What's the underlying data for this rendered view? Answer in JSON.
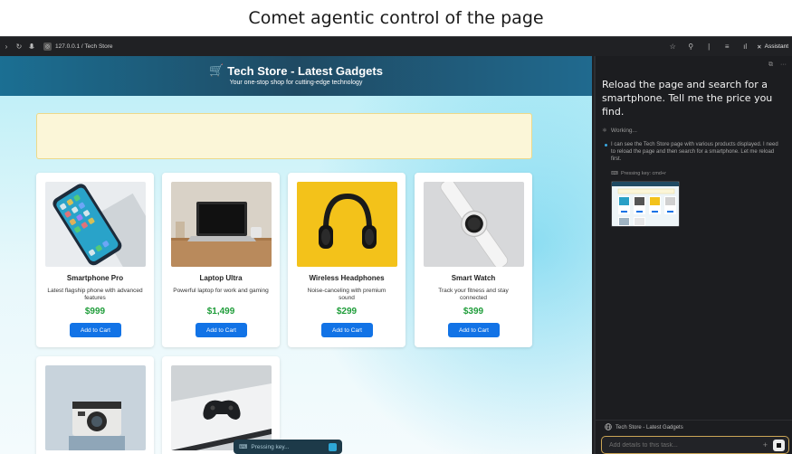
{
  "caption": "Comet agentic control of the page",
  "browser": {
    "address": "127.0.0.1 / Tech Store",
    "assistant_label": "Assistant"
  },
  "store": {
    "title": "Tech Store - Latest Gadgets",
    "subtitle": "Your one-stop shop for cutting-edge technology",
    "products": [
      {
        "name": "Smartphone Pro",
        "description": "Latest flagship phone with advanced features",
        "price": "$999",
        "cart_label": "Add to Cart"
      },
      {
        "name": "Laptop Ultra",
        "description": "Powerful laptop for work and gaming",
        "price": "$1,499",
        "cart_label": "Add to Cart"
      },
      {
        "name": "Wireless Headphones",
        "description": "Noise-canceling with premium sound",
        "price": "$299",
        "cart_label": "Add to Cart"
      },
      {
        "name": "Smart Watch",
        "description": "Track your fitness and stay connected",
        "price": "$399",
        "cart_label": "Add to Cart"
      }
    ],
    "pressing_status": "Pressing key..."
  },
  "assistant": {
    "query": "Reload the page and search for a smartphone. Tell me the price you find.",
    "status": "Working...",
    "step_text": "I can see the Tech Store page with various products displayed. I need to reload the page and then search for a smartphone. Let me reload first.",
    "action": "Pressing key: cmd+r",
    "tab_context": "Tech Store - Latest Gadgets",
    "input_placeholder": "Add details to this task..."
  }
}
